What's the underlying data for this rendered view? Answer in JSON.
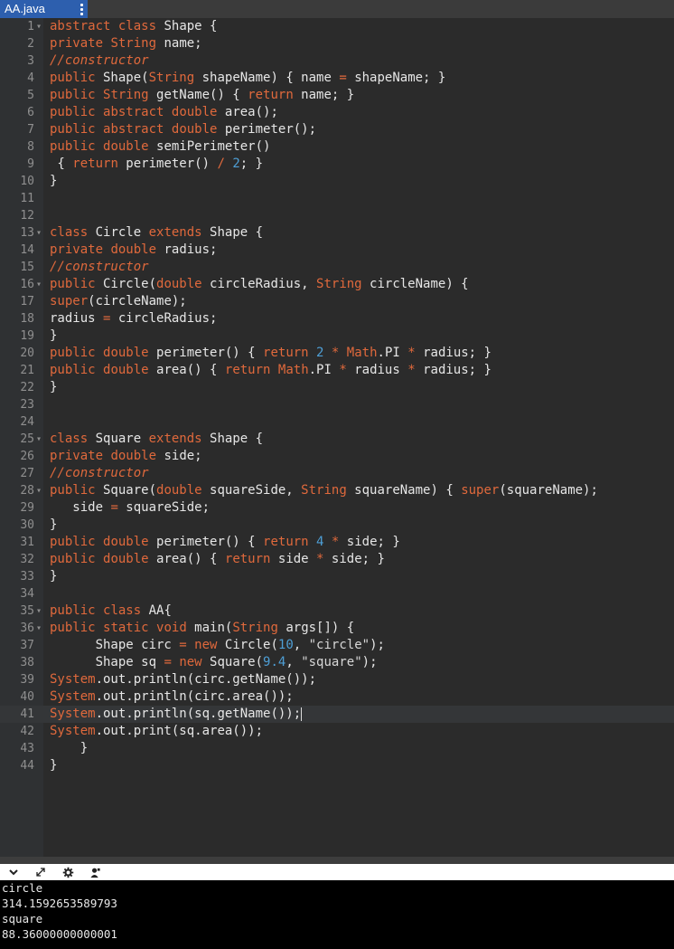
{
  "tab": {
    "filename": "AA.java"
  },
  "editor": {
    "active_line": 41,
    "fold_lines": [
      1,
      13,
      16,
      25,
      28,
      35,
      36
    ],
    "lines": [
      [
        [
          "kw",
          "abstract"
        ],
        [
          "t",
          " "
        ],
        [
          "kw",
          "class"
        ],
        [
          "t",
          " Shape {"
        ]
      ],
      [
        [
          "kw",
          "private"
        ],
        [
          "t",
          " "
        ],
        [
          "ty",
          "String"
        ],
        [
          "t",
          " name;"
        ]
      ],
      [
        [
          "cm",
          "//constructor"
        ]
      ],
      [
        [
          "kw",
          "public"
        ],
        [
          "t",
          " Shape("
        ],
        [
          "ty",
          "String"
        ],
        [
          "t",
          " shapeName) { name "
        ],
        [
          "op",
          "="
        ],
        [
          "t",
          " shapeName; }"
        ]
      ],
      [
        [
          "kw",
          "public"
        ],
        [
          "t",
          " "
        ],
        [
          "ty",
          "String"
        ],
        [
          "t",
          " getName() { "
        ],
        [
          "kw",
          "return"
        ],
        [
          "t",
          " name; }"
        ]
      ],
      [
        [
          "kw",
          "public"
        ],
        [
          "t",
          " "
        ],
        [
          "kw",
          "abstract"
        ],
        [
          "t",
          " "
        ],
        [
          "ty",
          "double"
        ],
        [
          "t",
          " area();"
        ]
      ],
      [
        [
          "kw",
          "public"
        ],
        [
          "t",
          " "
        ],
        [
          "kw",
          "abstract"
        ],
        [
          "t",
          " "
        ],
        [
          "ty",
          "double"
        ],
        [
          "t",
          " perimeter();"
        ]
      ],
      [
        [
          "kw",
          "public"
        ],
        [
          "t",
          " "
        ],
        [
          "ty",
          "double"
        ],
        [
          "t",
          " semiPerimeter()"
        ]
      ],
      [
        [
          "t",
          " { "
        ],
        [
          "kw",
          "return"
        ],
        [
          "t",
          " perimeter() "
        ],
        [
          "op",
          "/"
        ],
        [
          "t",
          " "
        ],
        [
          "num",
          "2"
        ],
        [
          "t",
          "; }"
        ]
      ],
      [
        [
          "t",
          "}"
        ]
      ],
      [],
      [],
      [
        [
          "kw",
          "class"
        ],
        [
          "t",
          " Circle "
        ],
        [
          "kw",
          "extends"
        ],
        [
          "t",
          " Shape {"
        ]
      ],
      [
        [
          "kw",
          "private"
        ],
        [
          "t",
          " "
        ],
        [
          "ty",
          "double"
        ],
        [
          "t",
          " radius;"
        ]
      ],
      [
        [
          "cm",
          "//constructor"
        ]
      ],
      [
        [
          "kw",
          "public"
        ],
        [
          "t",
          " Circle("
        ],
        [
          "ty",
          "double"
        ],
        [
          "t",
          " circleRadius, "
        ],
        [
          "ty",
          "String"
        ],
        [
          "t",
          " circleName) {"
        ]
      ],
      [
        [
          "kw",
          "super"
        ],
        [
          "t",
          "(circleName);"
        ]
      ],
      [
        [
          "t",
          "radius "
        ],
        [
          "op",
          "="
        ],
        [
          "t",
          " circleRadius;"
        ]
      ],
      [
        [
          "t",
          "}"
        ]
      ],
      [
        [
          "kw",
          "public"
        ],
        [
          "t",
          " "
        ],
        [
          "ty",
          "double"
        ],
        [
          "t",
          " perimeter() { "
        ],
        [
          "kw",
          "return"
        ],
        [
          "t",
          " "
        ],
        [
          "num",
          "2"
        ],
        [
          "t",
          " "
        ],
        [
          "op",
          "*"
        ],
        [
          "t",
          " "
        ],
        [
          "ty",
          "Math"
        ],
        [
          "t",
          ".PI "
        ],
        [
          "op",
          "*"
        ],
        [
          "t",
          " radius; }"
        ]
      ],
      [
        [
          "kw",
          "public"
        ],
        [
          "t",
          " "
        ],
        [
          "ty",
          "double"
        ],
        [
          "t",
          " area() { "
        ],
        [
          "kw",
          "return"
        ],
        [
          "t",
          " "
        ],
        [
          "ty",
          "Math"
        ],
        [
          "t",
          ".PI "
        ],
        [
          "op",
          "*"
        ],
        [
          "t",
          " radius "
        ],
        [
          "op",
          "*"
        ],
        [
          "t",
          " radius; }"
        ]
      ],
      [
        [
          "t",
          "}"
        ]
      ],
      [],
      [],
      [
        [
          "kw",
          "class"
        ],
        [
          "t",
          " Square "
        ],
        [
          "kw",
          "extends"
        ],
        [
          "t",
          " Shape {"
        ]
      ],
      [
        [
          "kw",
          "private"
        ],
        [
          "t",
          " "
        ],
        [
          "ty",
          "double"
        ],
        [
          "t",
          " side;"
        ]
      ],
      [
        [
          "cm",
          "//constructor"
        ]
      ],
      [
        [
          "kw",
          "public"
        ],
        [
          "t",
          " Square("
        ],
        [
          "ty",
          "double"
        ],
        [
          "t",
          " squareSide, "
        ],
        [
          "ty",
          "String"
        ],
        [
          "t",
          " squareName) { "
        ],
        [
          "kw",
          "super"
        ],
        [
          "t",
          "(squareName);"
        ]
      ],
      [
        [
          "t",
          "   side "
        ],
        [
          "op",
          "="
        ],
        [
          "t",
          " squareSide;"
        ]
      ],
      [
        [
          "t",
          "}"
        ]
      ],
      [
        [
          "kw",
          "public"
        ],
        [
          "t",
          " "
        ],
        [
          "ty",
          "double"
        ],
        [
          "t",
          " perimeter() { "
        ],
        [
          "kw",
          "return"
        ],
        [
          "t",
          " "
        ],
        [
          "num",
          "4"
        ],
        [
          "t",
          " "
        ],
        [
          "op",
          "*"
        ],
        [
          "t",
          " side; }"
        ]
      ],
      [
        [
          "kw",
          "public"
        ],
        [
          "t",
          " "
        ],
        [
          "ty",
          "double"
        ],
        [
          "t",
          " area() { "
        ],
        [
          "kw",
          "return"
        ],
        [
          "t",
          " side "
        ],
        [
          "op",
          "*"
        ],
        [
          "t",
          " side; }"
        ]
      ],
      [
        [
          "t",
          "}"
        ]
      ],
      [],
      [
        [
          "kw",
          "public"
        ],
        [
          "t",
          " "
        ],
        [
          "kw",
          "class"
        ],
        [
          "t",
          " AA{"
        ]
      ],
      [
        [
          "kw",
          "public"
        ],
        [
          "t",
          " "
        ],
        [
          "kw",
          "static"
        ],
        [
          "t",
          " "
        ],
        [
          "ty",
          "void"
        ],
        [
          "t",
          " main("
        ],
        [
          "ty",
          "String"
        ],
        [
          "t",
          " args[]) {"
        ]
      ],
      [
        [
          "t",
          "      Shape circ "
        ],
        [
          "op",
          "="
        ],
        [
          "t",
          " "
        ],
        [
          "kw",
          "new"
        ],
        [
          "t",
          " Circle("
        ],
        [
          "num",
          "10"
        ],
        [
          "t",
          ", "
        ],
        [
          "str",
          "\"circle\""
        ],
        [
          "t",
          ");"
        ]
      ],
      [
        [
          "t",
          "      Shape sq "
        ],
        [
          "op",
          "="
        ],
        [
          "t",
          " "
        ],
        [
          "kw",
          "new"
        ],
        [
          "t",
          " Square("
        ],
        [
          "num",
          "9.4"
        ],
        [
          "t",
          ", "
        ],
        [
          "str",
          "\"square\""
        ],
        [
          "t",
          ");"
        ]
      ],
      [
        [
          "ty",
          "System"
        ],
        [
          "t",
          ".out.println(circ.getName());"
        ]
      ],
      [
        [
          "ty",
          "System"
        ],
        [
          "t",
          ".out.println(circ.area());"
        ]
      ],
      [
        [
          "ty",
          "System"
        ],
        [
          "t",
          ".out.println(sq.getName());"
        ]
      ],
      [
        [
          "ty",
          "System"
        ],
        [
          "t",
          ".out.print(sq.area());"
        ]
      ],
      [
        [
          "t",
          "    }"
        ]
      ],
      [
        [
          "t",
          "}"
        ]
      ]
    ]
  },
  "console": {
    "toolbar_icons": [
      "chevron-down-icon",
      "expand-icon",
      "gear-icon",
      "user-icon"
    ],
    "output": [
      "circle",
      "314.1592653589793",
      "square",
      "88.36000000000001"
    ]
  }
}
